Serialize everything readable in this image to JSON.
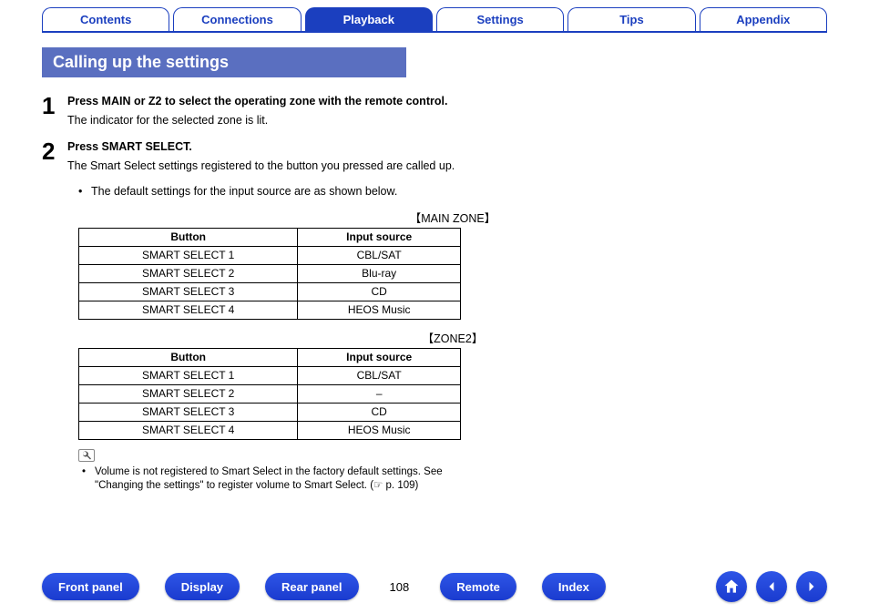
{
  "tabs": [
    {
      "label": "Contents",
      "active": false
    },
    {
      "label": "Connections",
      "active": false
    },
    {
      "label": "Playback",
      "active": true
    },
    {
      "label": "Settings",
      "active": false
    },
    {
      "label": "Tips",
      "active": false
    },
    {
      "label": "Appendix",
      "active": false
    }
  ],
  "section_title": "Calling up the settings",
  "steps": [
    {
      "num": "1",
      "head": "Press MAIN or Z2 to select the operating zone with the remote control.",
      "sub": "The indicator for the selected zone is lit."
    },
    {
      "num": "2",
      "head": "Press SMART SELECT.",
      "sub": "The Smart Select settings registered to the button you pressed are called up."
    }
  ],
  "default_bullet": "The default settings for the input source are as shown below.",
  "tables": [
    {
      "caption": "【MAIN ZONE】",
      "headers": [
        "Button",
        "Input source"
      ],
      "rows": [
        [
          "SMART SELECT 1",
          "CBL/SAT"
        ],
        [
          "SMART SELECT 2",
          "Blu-ray"
        ],
        [
          "SMART SELECT 3",
          "CD"
        ],
        [
          "SMART SELECT 4",
          "HEOS Music"
        ]
      ]
    },
    {
      "caption": "【ZONE2】",
      "headers": [
        "Button",
        "Input source"
      ],
      "rows": [
        [
          "SMART SELECT 1",
          "CBL/SAT"
        ],
        [
          "SMART SELECT 2",
          "–"
        ],
        [
          "SMART SELECT 3",
          "CD"
        ],
        [
          "SMART SELECT 4",
          "HEOS Music"
        ]
      ]
    }
  ],
  "note": "Volume is not registered to Smart Select in the factory default settings. See \"Changing the settings\" to register volume to Smart Select. (☞ p. 109)",
  "bottom": {
    "buttons": [
      "Front panel",
      "Display",
      "Rear panel"
    ],
    "page": "108",
    "buttons2": [
      "Remote",
      "Index"
    ]
  }
}
